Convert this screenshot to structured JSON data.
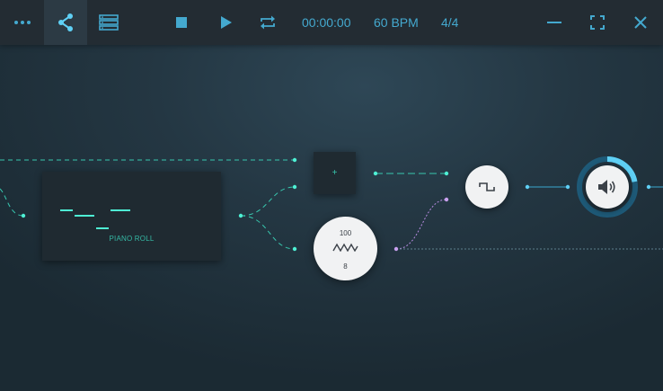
{
  "toolbar": {
    "icons": [
      "more-icon",
      "share-icon",
      "list-icon",
      "stop-icon",
      "play-icon",
      "loop-icon",
      "minimize-icon",
      "fullscreen-icon",
      "close-icon"
    ],
    "time": "00:00:00",
    "tempo": "60 BPM",
    "signature": "4/4"
  },
  "canvas": {
    "piano_roll": {
      "label": "PIANO ROLL"
    },
    "add_node": {
      "label": "+"
    },
    "lfo": {
      "value_top": "100",
      "value_bottom": "8",
      "icon": "triangle-wave-icon"
    },
    "oscillator": {
      "icon": "square-wave-icon"
    },
    "output": {
      "icon": "speaker-icon",
      "level": 0.22
    }
  },
  "colors": {
    "accent": "#44a9cf",
    "cable": "#38c7ae",
    "modulation": "#b68be0",
    "meter": "#5fd0f5",
    "toolbar_bg": "#232c33"
  }
}
